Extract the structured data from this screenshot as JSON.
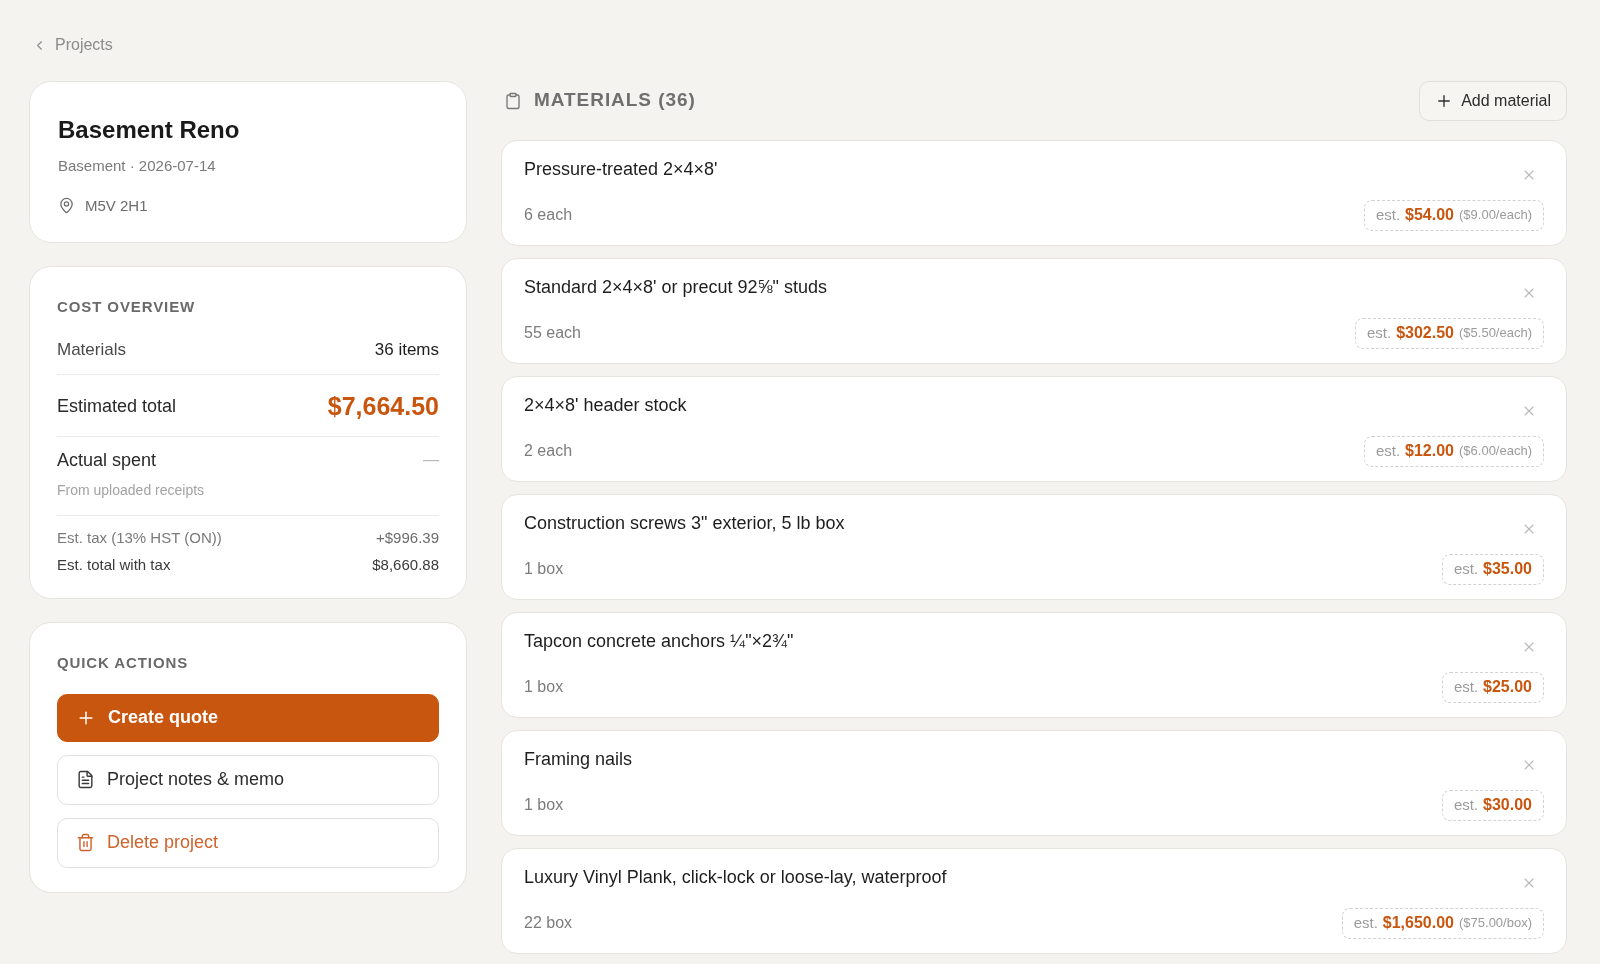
{
  "breadcrumb": {
    "label": "Projects"
  },
  "project": {
    "title": "Basement Reno",
    "subtitle": "Basement · 2026-07-14",
    "location": "M5V 2H1"
  },
  "cost_overview": {
    "heading": "COST OVERVIEW",
    "rows": [
      {
        "kind": "count",
        "label": "Materials",
        "value": "36 items"
      },
      {
        "kind": "total",
        "label": "Estimated total",
        "value": "$7,664.50"
      },
      {
        "kind": "actual",
        "label": "Actual spent",
        "note": "From uploaded receipts",
        "value": "—"
      },
      {
        "kind": "tax",
        "label": "Est. tax (13% HST (ON))",
        "value": "+$996.39"
      },
      {
        "kind": "grand",
        "label": "Est. total with tax",
        "value": "$8,660.88"
      }
    ]
  },
  "quick_actions": {
    "heading": "QUICK ACTIONS",
    "actions": [
      {
        "kind": "primary",
        "label": "Create quote"
      },
      {
        "kind": "notes",
        "label": "Project notes & memo"
      },
      {
        "kind": "danger",
        "label": "Delete project"
      }
    ]
  },
  "materials": {
    "heading": "MATERIALS (36)",
    "add_button": "Add material",
    "items": [
      {
        "name": "Pressure-treated 2×4×8'",
        "quantity": "6 each",
        "est_label": "est.",
        "estimate": "$54.00",
        "unit_price": "($9.00/each)"
      },
      {
        "name": "Standard 2×4×8' or precut 92⅝\" studs",
        "quantity": "55 each",
        "est_label": "est.",
        "estimate": "$302.50",
        "unit_price": "($5.50/each)"
      },
      {
        "name": "2×4×8' header stock",
        "quantity": "2 each",
        "est_label": "est.",
        "estimate": "$12.00",
        "unit_price": "($6.00/each)"
      },
      {
        "name": "Construction screws 3\" exterior, 5 lb box",
        "quantity": "1 box",
        "est_label": "est.",
        "estimate": "$35.00"
      },
      {
        "name": "Tapcon concrete anchors ¼\"×2¾\"",
        "quantity": "1 box",
        "est_label": "est.",
        "estimate": "$25.00"
      },
      {
        "name": "Framing nails",
        "quantity": "1 box",
        "est_label": "est.",
        "estimate": "$30.00"
      },
      {
        "name": "Luxury Vinyl Plank, click-lock or loose-lay, waterproof",
        "quantity": "22 box",
        "est_label": "est.",
        "estimate": "$1,650.00",
        "unit_price": "($75.00/box)"
      }
    ]
  }
}
